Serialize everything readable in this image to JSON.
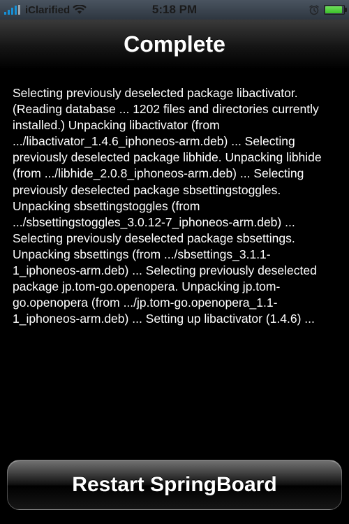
{
  "status_bar": {
    "carrier": "iClarified",
    "time": "5:18 PM"
  },
  "header": {
    "title": "Complete"
  },
  "log_text": "Selecting previously deselected package libactivator.\n(Reading database ... 1202 files and directories currently installed.)\nUnpacking libactivator (from .../libactivator_1.4.6_iphoneos-arm.deb) ...\nSelecting previously deselected package libhide.\nUnpacking libhide (from .../libhide_2.0.8_iphoneos-arm.deb) ...\nSelecting previously deselected package sbsettingstoggles.\nUnpacking sbsettingstoggles (from .../sbsettingstoggles_3.0.12-7_iphoneos-arm.deb) ...\nSelecting previously deselected package sbsettings.\nUnpacking sbsettings (from .../sbsettings_3.1.1-1_iphoneos-arm.deb) ...\nSelecting previously deselected package jp.tom-go.openopera.\nUnpacking jp.tom-go.openopera (from .../jp.tom-go.openopera_1.1-1_iphoneos-arm.deb) ...\nSetting up libactivator (1.4.6) ...",
  "footer": {
    "button_label": "Restart SpringBoard"
  }
}
